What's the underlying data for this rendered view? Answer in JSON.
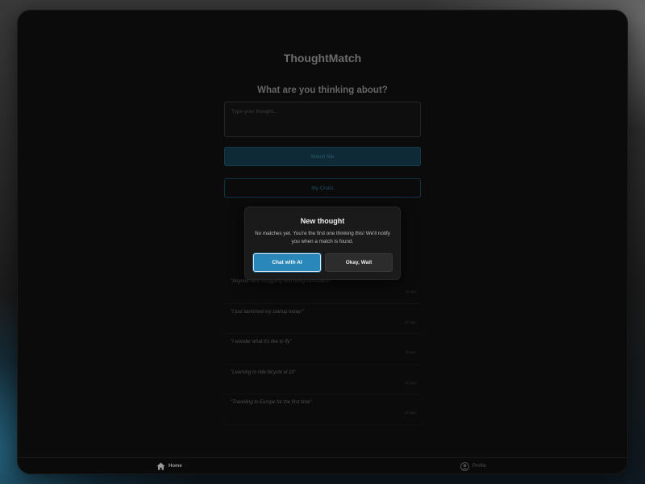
{
  "app": {
    "title": "ThoughtMatch",
    "question": "What are you thinking about?",
    "input_placeholder": "Type your thought...",
    "match_button": "Match Me",
    "chats_button": "My Chats"
  },
  "feed": [
    {
      "text": "\"Anyone here struggling with being consistent?\"",
      "time": "1h ago"
    },
    {
      "text": "\"I just launched my startup today!\"",
      "time": "2h ago"
    },
    {
      "text": "\"I wonder what it's like to fly\"",
      "time": "3h ago"
    },
    {
      "text": "\"Learning to ride bicycle at 20\"",
      "time": "4h ago"
    },
    {
      "text": "\"Travelling to Europe for the first time\"",
      "time": "5h ago"
    }
  ],
  "modal": {
    "title": "New thought",
    "body": "No matches yet. You're the first one thinking this! We'll notify you when a match is found.",
    "primary_button": "Chat with AI",
    "secondary_button": "Okay, Wait"
  },
  "nav": {
    "home": "Home",
    "profile": "Profile",
    "home_icon": "home-icon",
    "profile_icon": "user-circle-icon"
  },
  "colors": {
    "accent": "#2a87b9",
    "modal_bg": "#1a1a1a",
    "app_bg": "#0b0b0b"
  }
}
